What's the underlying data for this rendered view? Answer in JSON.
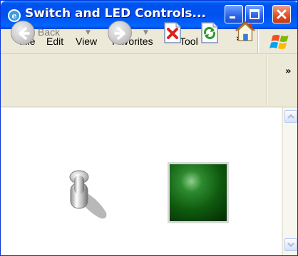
{
  "window": {
    "title": "Switch and LED Controls...",
    "controls": {
      "minimize": "minimize",
      "maximize": "maximize",
      "close": "close"
    }
  },
  "menu": {
    "items": [
      "File",
      "Edit",
      "View",
      "Favorites",
      "Tool"
    ],
    "overflow": "»"
  },
  "toolbar": {
    "back_label": "Back",
    "overflow": "»",
    "icons": [
      "back-arrow",
      "forward-arrow",
      "stop-x",
      "refresh",
      "home"
    ]
  },
  "content": {
    "switch_state": "off",
    "led_color": "#1E6B1E",
    "led_lit": false
  },
  "colors": {
    "titlebar": "#0055EA",
    "chrome": "#ECE9D8",
    "close_button": "#E0542C"
  }
}
